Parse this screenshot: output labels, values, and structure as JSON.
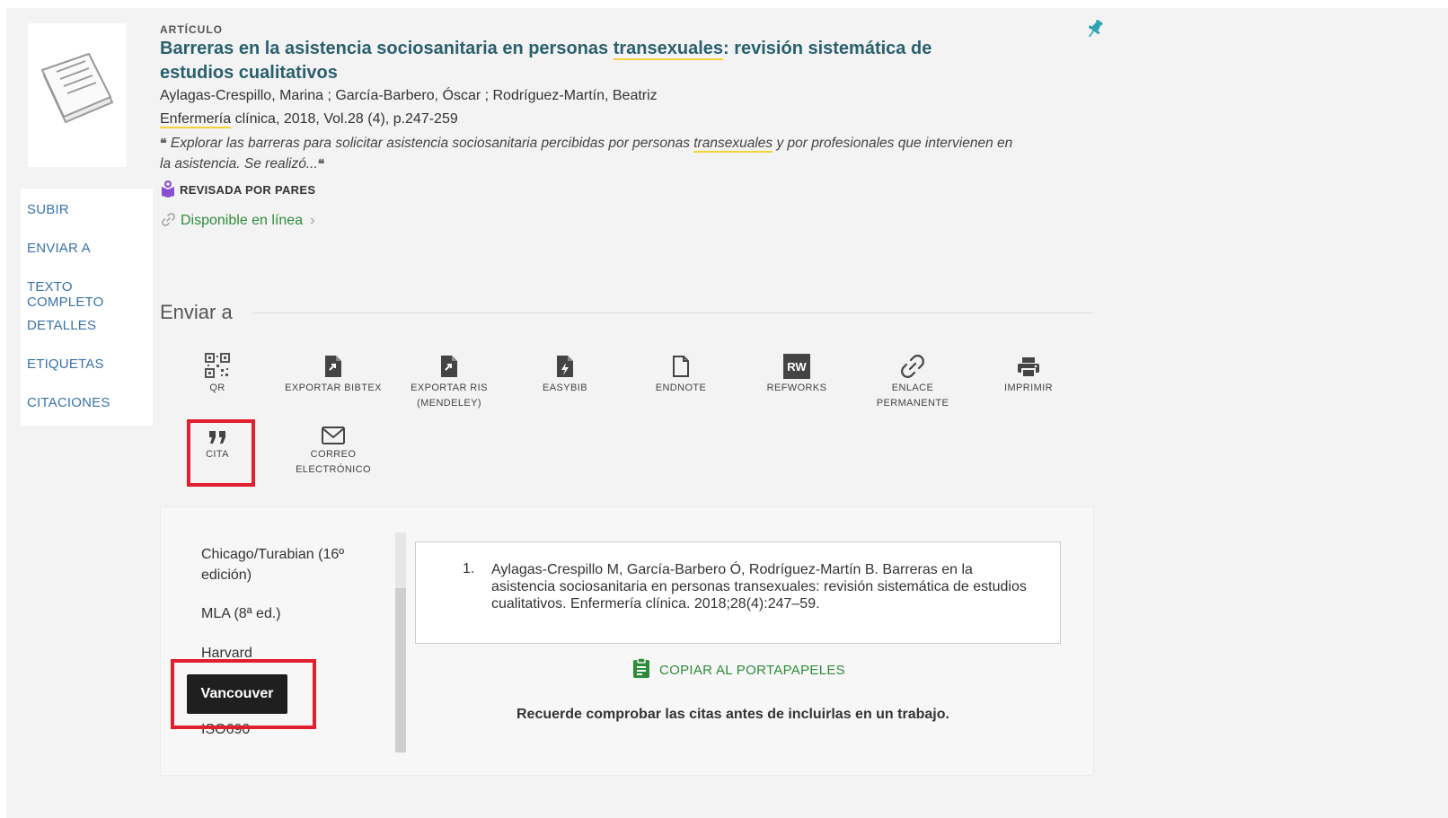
{
  "record": {
    "type": "ARTÍCULO",
    "title_pre": "Barreras en la asistencia sociosanitaria en personas ",
    "title_hl": "transexuales",
    "title_post": ": revisión sistemática de estudios cualitativos",
    "authors": "Aylagas-Crespillo, Marina ; García-Barbero, Óscar ; Rodríguez-Martín, Beatriz",
    "source_hl": "Enfermería",
    "source_rest": " clínica, 2018, Vol.28 (4), p.247-259",
    "abstract_pre": "Explorar las barreras para solicitar asistencia sociosanitaria percibidas por personas ",
    "abstract_hl": "transexuales",
    "abstract_post": " y por profesionales que intervienen en la asistencia. Se realizó...",
    "quote_mark": "❝",
    "peer_reviewed": "REVISADA POR PARES",
    "availability": "Disponible en línea",
    "availability_chevron": "›"
  },
  "side_nav": {
    "items": [
      {
        "label": "SUBIR"
      },
      {
        "label": "ENVIAR A"
      },
      {
        "label": "TEXTO COMPLETO"
      },
      {
        "label": "DETALLES"
      },
      {
        "label": "ETIQUETAS"
      },
      {
        "label": "CITACIONES"
      }
    ]
  },
  "send_to": {
    "title": "Enviar a",
    "actions": [
      {
        "label": "QR",
        "icon": "qr-icon"
      },
      {
        "label": "EXPORTAR BIBTEX",
        "icon": "file-export-icon"
      },
      {
        "label": "EXPORTAR RIS (MENDELEY)",
        "icon": "file-export-icon"
      },
      {
        "label": "EASYBIB",
        "icon": "file-bolt-icon"
      },
      {
        "label": "ENDNOTE",
        "icon": "file-outline-icon"
      },
      {
        "label": "REFWORKS",
        "icon": "refworks-icon",
        "icon_text": "RW"
      },
      {
        "label": "ENLACE PERMANENTE",
        "icon": "link-icon"
      },
      {
        "label": "IMPRIMIR",
        "icon": "print-icon"
      },
      {
        "label": "CITA",
        "icon": "quote-icon"
      },
      {
        "label": "CORREO ELECTRÓNICO",
        "icon": "mail-icon"
      }
    ]
  },
  "citation": {
    "styles": [
      {
        "label": "Chicago/Turabian (16º edición)"
      },
      {
        "label": "MLA (8ª ed.)"
      },
      {
        "label": "Harvard"
      },
      {
        "label": "Vancouver",
        "selected": true
      },
      {
        "label": "ISO690"
      }
    ],
    "number": "1.",
    "text": "Aylagas-Crespillo M, García-Barbero Ó, Rodríguez-Martín B. Barreras en la asistencia sociosanitaria en personas transexuales: revisión sistemática de estudios cualitativos. Enfermería clínica. 2018;28(4):247–59.",
    "copy_label": "COPIAR AL PORTAPAPELES",
    "note": "Recuerde comprobar las citas antes de incluirlas en un trabajo."
  },
  "colors": {
    "accent_teal": "#2a5f6e",
    "link_blue": "#3a72a8",
    "green": "#2e8b3a",
    "highlight_yellow": "#f2d43a",
    "annotation_red": "#e0202c"
  }
}
